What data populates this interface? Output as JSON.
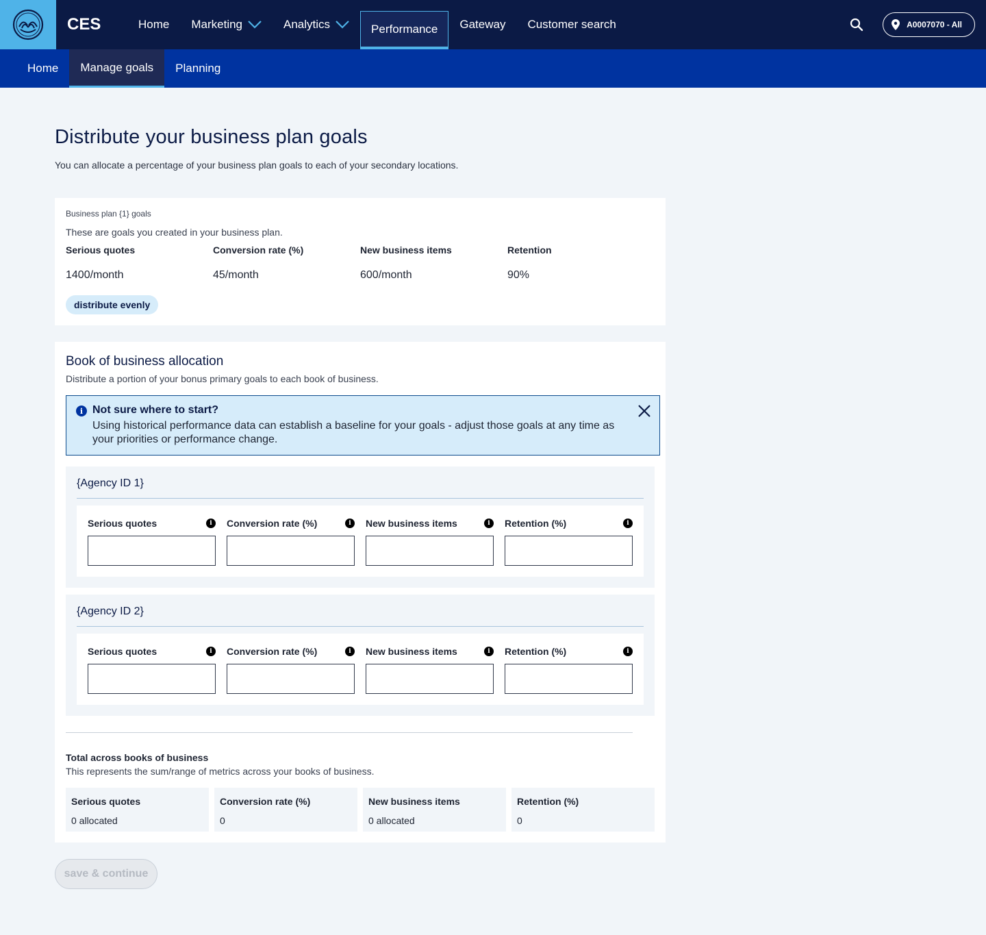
{
  "topnav": {
    "app_name": "CES",
    "items": [
      {
        "label": "Home"
      },
      {
        "label": "Marketing"
      },
      {
        "label": "Analytics"
      },
      {
        "label": "Performance"
      },
      {
        "label": "Gateway"
      },
      {
        "label": "Customer search"
      }
    ],
    "location_label": "A0007070 - All",
    "accent_color": "#4fb3e8",
    "bg_color": "#0b1a45"
  },
  "subnav": {
    "items": [
      {
        "label": "Home"
      },
      {
        "label": "Manage goals"
      },
      {
        "label": "Planning"
      }
    ],
    "bg_color": "#0033a0"
  },
  "page": {
    "title": "Distribute your business plan goals",
    "description": "You can allocate a percentage of your business plan goals to each of your secondary locations."
  },
  "business_plan": {
    "subtitle": "Business plan {1} goals",
    "description": "These are goals you created in your business plan.",
    "goals": [
      {
        "label": "Serious quotes",
        "value": "1400/month"
      },
      {
        "label": "Conversion rate (%)",
        "value": "45/month"
      },
      {
        "label": "New business items",
        "value": "600/month"
      },
      {
        "label": "Retention",
        "value": "90%"
      }
    ],
    "distribute_label": "distribute evenly"
  },
  "allocation": {
    "title": "Book of business allocation",
    "description": "Distribute a portion of your bonus primary goals to each book of business.",
    "alert": {
      "title": "Not sure where to start?",
      "body": "Using historical performance data can establish a baseline for your goals - adjust those goals at any time as your priorities or performance change."
    },
    "agencies": [
      {
        "title": "{Agency ID 1}",
        "fields": [
          {
            "label": "Serious quotes",
            "value": ""
          },
          {
            "label": "Conversion rate (%)",
            "value": ""
          },
          {
            "label": "New business items",
            "value": ""
          },
          {
            "label": "Retention (%)",
            "value": ""
          }
        ]
      },
      {
        "title": "{Agency ID 2}",
        "fields": [
          {
            "label": "Serious quotes",
            "value": ""
          },
          {
            "label": "Conversion rate (%)",
            "value": ""
          },
          {
            "label": "New business items",
            "value": ""
          },
          {
            "label": "Retention (%)",
            "value": ""
          }
        ]
      }
    ],
    "totals": {
      "title": "Total across books of business",
      "description": "This represents the sum/range of metrics across your books of business.",
      "cells": [
        {
          "label": "Serious quotes",
          "value": "0 allocated"
        },
        {
          "label": "Conversion rate (%)",
          "value": "0"
        },
        {
          "label": "New business items",
          "value": "0 allocated"
        },
        {
          "label": "Retention (%)",
          "value": "0"
        }
      ]
    }
  },
  "footer": {
    "save_label": "save & continue"
  }
}
